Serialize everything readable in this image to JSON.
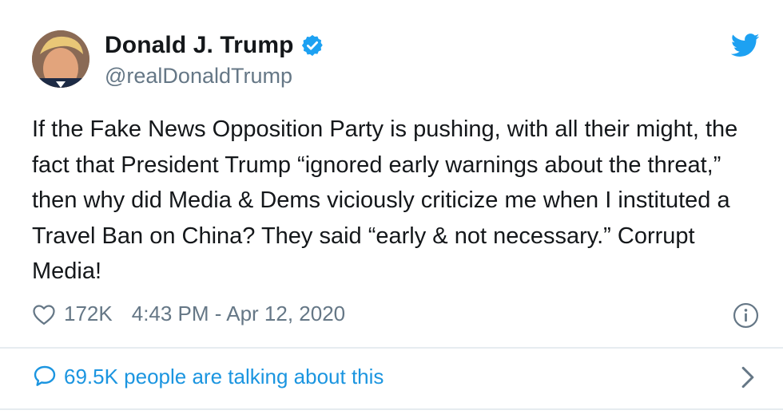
{
  "tweet": {
    "author_name": "Donald J. Trump",
    "handle": "@realDonaldTrump",
    "text": "If the Fake News Opposition Party is pushing, with all their might, the fact that President Trump “ignored early warnings about the threat,” then why did Media & Dems viciously criticize me when I instituted a Travel Ban on China? They said “early & not necessary.” Corrupt Media!",
    "likes": "172K",
    "timestamp": "4:43 PM - Apr 12, 2020",
    "talking_text": "69.5K people are talking about this"
  },
  "icons": {
    "verified": "verified-badge-icon",
    "bird": "twitter-bird-icon",
    "heart": "heart-icon",
    "info": "info-icon",
    "bubble": "speech-bubble-icon",
    "chevron": "chevron-right-icon"
  },
  "colors": {
    "accent": "#1da1f2",
    "link": "#1b95e0",
    "muted": "#657786",
    "text": "#14171a",
    "divider": "#e6ecf0"
  }
}
